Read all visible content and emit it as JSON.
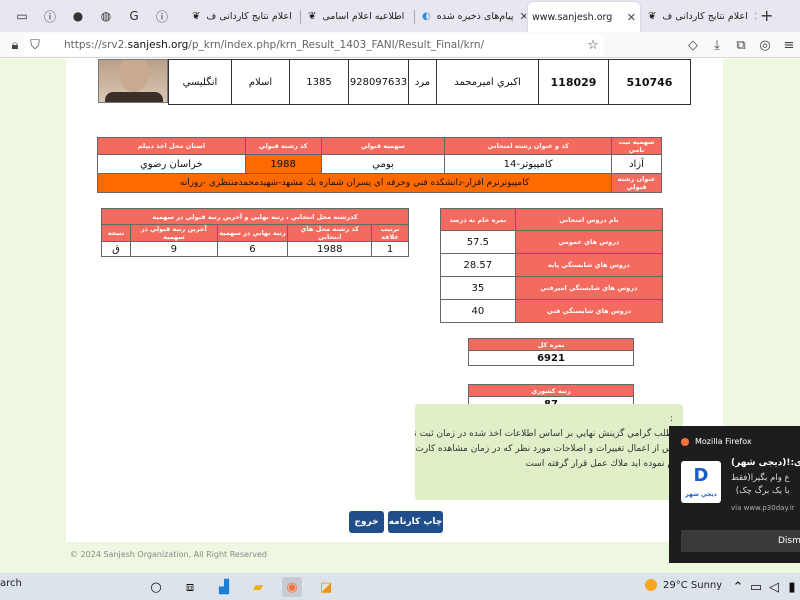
{
  "browser": {
    "tabs": [
      {
        "label": "اعلام نتايج كاردانى ف",
        "favicon": "sanjesh-icon",
        "active": false
      },
      {
        "label": "اطلاعيه اعلام اسامى",
        "favicon": "sanjesh-icon",
        "active": false
      },
      {
        "label": "پیام‌های ذخیره شده",
        "favicon": "telegram-icon",
        "active": false
      },
      {
        "label": "www.sanjesh.org",
        "favicon": "",
        "active": true
      },
      {
        "label": "اعلام نتايج كاردانى ف",
        "favicon": "sanjesh-icon",
        "active": false
      }
    ],
    "url_prefix": "https://srv2.",
    "url_domain": "sanjesh.org",
    "url_path": "/p_krn/index.php/krn_Result_1403_FANI/Result_Final/krn/"
  },
  "person": {
    "cells": [
      "510746",
      "118029",
      "اكبري اميرمحمد",
      "مرد",
      "928097633",
      "1385",
      "اسلام",
      "انگليسي"
    ]
  },
  "major": {
    "headers": [
      "سهميه ثبت نامي",
      "كد و عنوان رشته امتحاني",
      "سهميه قبولي",
      "كد رشته قبولي",
      "استان محل اخذ ديپلم"
    ],
    "values": [
      "آزاد",
      "14-كامپيوتر",
      "بومي",
      "1988",
      "خراسان رضوي"
    ],
    "accepted_label": "عنوان رشته قبولي",
    "accepted_value": "كامپيوترنرم افزار-دانشكده فني وحرفه اي پسران شماره يك مشهد-شهيدمحمدمنتظري -روزانه"
  },
  "choices": {
    "title": "كدرشته محل انتخابي ، رتبه نهايي و آخرين رتبه قبولي در سهميه",
    "headers": [
      "ترتيب علاقه",
      "كد رشته محل هاي انتخابي",
      "رتبه نهايي در سهميه",
      "آخرين رتبه قبولي در سهميه",
      "نتيجه"
    ],
    "rows": [
      [
        "1",
        "1988",
        "6",
        "9",
        "ق"
      ]
    ]
  },
  "scores": {
    "headers": [
      "نام دروس امتحاني",
      "نمره خام به درصد"
    ],
    "rows": [
      {
        "name": "دروس هاي عمومي",
        "value": "57.5"
      },
      {
        "name": "دروس هاي شايستگي پايه",
        "value": "28.57"
      },
      {
        "name": "دروس هاي شايستگي اميرفني",
        "value": "35"
      },
      {
        "name": "دروس هاي شايستگي فني",
        "value": "40"
      }
    ]
  },
  "total": {
    "label": "نمره كل",
    "value": "6921"
  },
  "rank": {
    "label": "رتبه كشوري",
    "value": "87"
  },
  "notice": {
    "lines": [
      ":",
      "طلب گرامي گزينش نهايي بر اساس اطلاعات اخذ شده در زمان ثبت نام",
      "س از اعمال تغييرات و اصلاحات مورد نظر كه در زمان مشاهده كارت",
      "م نموده ايد ملاك عمل قرار گرفته است"
    ]
  },
  "buttons": {
    "print": "چاپ كارنامه",
    "exit": "خروج"
  },
  "footer": {
    "copyright": "© 2024 Sanjesh Organization, All Right Reserved"
  },
  "notification": {
    "app": "Mozilla Firefox",
    "logo_text": "D",
    "logo_sub": "ديجي شهر",
    "title": "ری:!(دیجی شهر)",
    "body_line1": "ع وام بگيرا(فقط",
    "body_line2": "با يک برگ چک)",
    "source": "via www.p30day.ir",
    "dismiss": "Dism"
  },
  "taskbar": {
    "search": "arch",
    "weather": "29°C  Sunny"
  }
}
